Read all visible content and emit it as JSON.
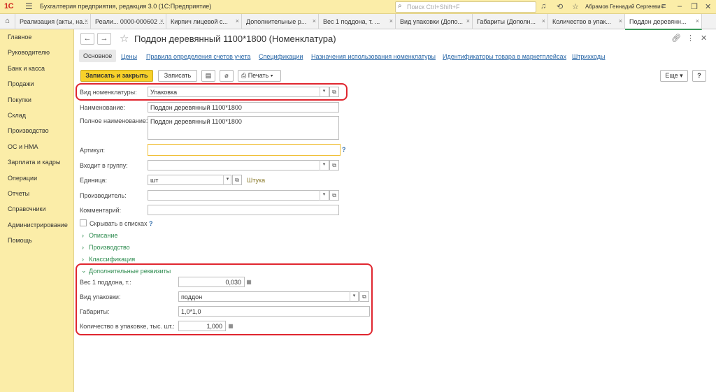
{
  "app": {
    "logo": "1С",
    "title": "Бухгалтерия предприятия, редакция 3.0  (1С:Предприятие)",
    "search_placeholder": "Поиск Ctrl+Shift+F",
    "user": "Абрамов Геннадий Сергеевич"
  },
  "tabs": [
    {
      "label": "Реализация (акты, на..."
    },
    {
      "label": "Реали... 0000-000602 ..."
    },
    {
      "label": "Кирпич лицевой с..."
    },
    {
      "label": "Дополнительные р..."
    },
    {
      "label": "Вес 1 поддона, т. ..."
    },
    {
      "label": "Вид упаковки (Допо..."
    },
    {
      "label": "Габариты (Дополн..."
    },
    {
      "label": "Количество в упак..."
    },
    {
      "label": "Поддон деревянн..."
    }
  ],
  "sidebar": {
    "items": [
      {
        "label": "Главное"
      },
      {
        "label": "Руководителю"
      },
      {
        "label": "Банк и касса"
      },
      {
        "label": "Продажи"
      },
      {
        "label": "Покупки"
      },
      {
        "label": "Склад"
      },
      {
        "label": "Производство"
      },
      {
        "label": "ОС и НМА"
      },
      {
        "label": "Зарплата и кадры"
      },
      {
        "label": "Операции"
      },
      {
        "label": "Отчеты"
      },
      {
        "label": "Справочники"
      },
      {
        "label": "Администрирование"
      },
      {
        "label": "Помощь"
      }
    ]
  },
  "form": {
    "title": "Поддон  деревянный 1100*1800 (Номенклатура)",
    "sections": [
      {
        "label": "Основное"
      },
      {
        "label": "Цены"
      },
      {
        "label": "Правила определения счетов учета"
      },
      {
        "label": "Спецификации"
      },
      {
        "label": "Назначения использования номенклатуры"
      },
      {
        "label": "Идентификаторы товара в маркетплейсах"
      },
      {
        "label": "Штрихкоды"
      }
    ],
    "toolbar": {
      "save_close": "Записать и закрыть",
      "save": "Записать",
      "print": "Печать",
      "more": "Еще",
      "help": "?"
    },
    "fields": {
      "kind_label": "Вид номенклатуры:",
      "kind_value": "Упаковка",
      "name_label": "Наименование:",
      "name_value": "Поддон  деревянный 1100*1800",
      "fullname_label": "Полное наименование:",
      "fullname_value": "Поддон  деревянный 1100*1800",
      "article_label": "Артикул:",
      "article_value": "",
      "group_label": "Входит в группу:",
      "group_value": "",
      "unit_label": "Единица:",
      "unit_value": "шт",
      "unit_name": "Штука",
      "maker_label": "Производитель:",
      "maker_value": "",
      "comment_label": "Комментарий:",
      "comment_value": "",
      "hide_label": "Скрывать в списках",
      "help_mark": "?"
    },
    "groups": {
      "description": "Описание",
      "production": "Производство",
      "classification": "Классификация",
      "additional": "Дополнительные реквизиты"
    },
    "additional": {
      "weight_label": "Вес 1 поддона, т.:",
      "weight_value": "0,030",
      "pack_label": "Вид упаковки:",
      "pack_value": "поддон",
      "size_label": "Габариты:",
      "size_value": "1,0*1,0",
      "qty_label": "Количество в упаковке, тыс. шт.:",
      "qty_value": "1,000"
    }
  }
}
